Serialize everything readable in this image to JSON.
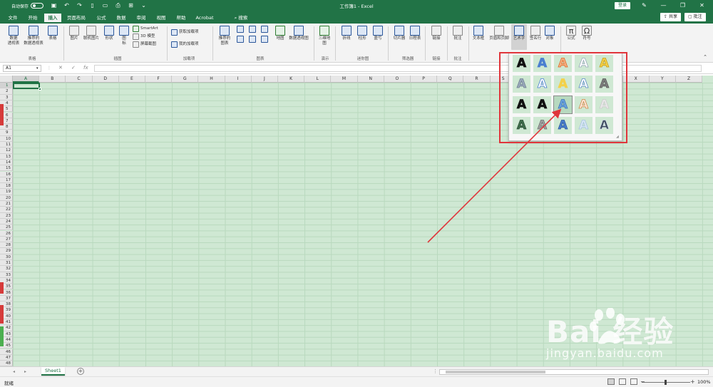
{
  "window": {
    "autosave_label": "自动保存",
    "autosave_state": "关",
    "title": "工作簿1 - Excel",
    "login_label": "登录",
    "window_controls": [
      "—",
      "❐",
      "✕"
    ]
  },
  "tabs": [
    {
      "label": "文件",
      "active": false
    },
    {
      "label": "开始",
      "active": false
    },
    {
      "label": "插入",
      "active": true
    },
    {
      "label": "页面布局",
      "active": false
    },
    {
      "label": "公式",
      "active": false
    },
    {
      "label": "数据",
      "active": false
    },
    {
      "label": "审阅",
      "active": false
    },
    {
      "label": "视图",
      "active": false
    },
    {
      "label": "帮助",
      "active": false
    },
    {
      "label": "Acrobat",
      "active": false
    },
    {
      "label": "搜索",
      "active": false
    }
  ],
  "share_label": "共享",
  "comments_label": "批注",
  "ribbon": {
    "groups": {
      "tables": "表格",
      "illustrations": "插图",
      "addins": "加载项",
      "charts": "图表",
      "tours": "演示",
      "sparklines": "迷你图",
      "filters": "筛选器",
      "links": "链接",
      "comments": "批注",
      "text": "文本",
      "symbols": "符号"
    },
    "buttons": {
      "pivot_table": "数据\n透视表",
      "recommended_pivot": "推荐的\n数据透视表",
      "table": "表格",
      "pictures": "图片",
      "online_pictures": "联机图片",
      "shapes": "形状",
      "icons": "图\n标",
      "smartart": "SmartArt",
      "model_3d": "3D 模型",
      "screenshot": "屏幕截图",
      "get_addins": "获取加载项",
      "my_addins": "我的加载项",
      "recommended_charts": "推荐的\n图表",
      "maps": "地图",
      "pivot_chart": "数据透视图",
      "map_3d": "三维地\n图",
      "line": "折线",
      "column": "柱形",
      "win_loss": "盈亏",
      "slicer": "切片器",
      "timeline": "日程表",
      "link": "链接",
      "comment": "批注",
      "text_box": "文本框",
      "header_footer": "页眉和页脚",
      "wordart": "艺术字",
      "signature_line": "签名行",
      "object": "对象",
      "equation": "公式",
      "symbol": "符号"
    }
  },
  "formula_bar": {
    "name_box": "A1",
    "cancel_icon": "✕",
    "enter_icon": "✓",
    "fx_label": "fx",
    "value": ""
  },
  "columns": [
    "A",
    "B",
    "C",
    "D",
    "E",
    "F",
    "G",
    "H",
    "I",
    "J",
    "K",
    "L",
    "M",
    "N",
    "O",
    "P",
    "Q",
    "R",
    "S",
    "T",
    "U",
    "V",
    "W",
    "X",
    "Y",
    "Z"
  ],
  "rows": [
    "1",
    "2",
    "3",
    "4",
    "5",
    "6",
    "7",
    "8",
    "9",
    "10",
    "11",
    "12",
    "13",
    "14",
    "15",
    "16",
    "17",
    "18",
    "19",
    "20",
    "21",
    "22",
    "23",
    "24",
    "25",
    "26",
    "27",
    "28",
    "29",
    "30",
    "31",
    "32",
    "33",
    "34",
    "35",
    "36",
    "37",
    "38",
    "39",
    "40",
    "41",
    "42",
    "43",
    "44",
    "45",
    "46",
    "47",
    "48"
  ],
  "selected_cell": "A1",
  "wordart_gallery": {
    "letter": "A",
    "styles": [
      {
        "fill": "#111111",
        "stroke": "#111111"
      },
      {
        "fill": "#4a7fd0",
        "stroke": "#4a7fd0"
      },
      {
        "fill": "#f4b183",
        "stroke": "#e06a2a"
      },
      {
        "fill": "#ffffff",
        "stroke": "#9aa9bb"
      },
      {
        "fill": "#f3d14a",
        "stroke": "#c79d1a"
      },
      {
        "fill": "#9aa9bb",
        "stroke": "#6f7f92"
      },
      {
        "fill": "#ffffff",
        "stroke": "#4a7fd0"
      },
      {
        "fill": "#f3d14a",
        "stroke": "#f3d14a"
      },
      {
        "fill": "#ffffff",
        "stroke": "#5c8bc8"
      },
      {
        "fill": "#7f7f7f",
        "stroke": "#595959"
      },
      {
        "fill": "#111111",
        "stroke": "#111111"
      },
      {
        "fill": "#111111",
        "stroke": "#111111"
      },
      {
        "fill": "#6ba3e0",
        "stroke": "#3e74b7"
      },
      {
        "fill": "#fbe5d6",
        "stroke": "#d08a4c"
      },
      {
        "fill": "#e8e8e8",
        "stroke": "#cccccc"
      },
      {
        "fill": "#3f6e4b",
        "stroke": "#2a4d34"
      },
      {
        "fill": "#a0a0a0",
        "stroke": "#707070"
      },
      {
        "fill": "#4a7fd0",
        "stroke": "#2a569a"
      },
      {
        "fill": "#d7e6f4",
        "stroke": "#a8c4e0"
      },
      {
        "fill": "#3a4a5c",
        "stroke": "#cfd9e6"
      }
    ],
    "hover_index": 12
  },
  "sheets": [
    {
      "name": "Sheet1",
      "active": true
    }
  ],
  "status": {
    "ready_label": "就绪",
    "zoom": "100%"
  },
  "watermark": {
    "brand": "Bai  经验",
    "url": "jingyan.baidu.com"
  },
  "colors": {
    "excel_green": "#217346",
    "highlight_red": "#e0353b",
    "grid_tint": "#cfe8d3"
  }
}
